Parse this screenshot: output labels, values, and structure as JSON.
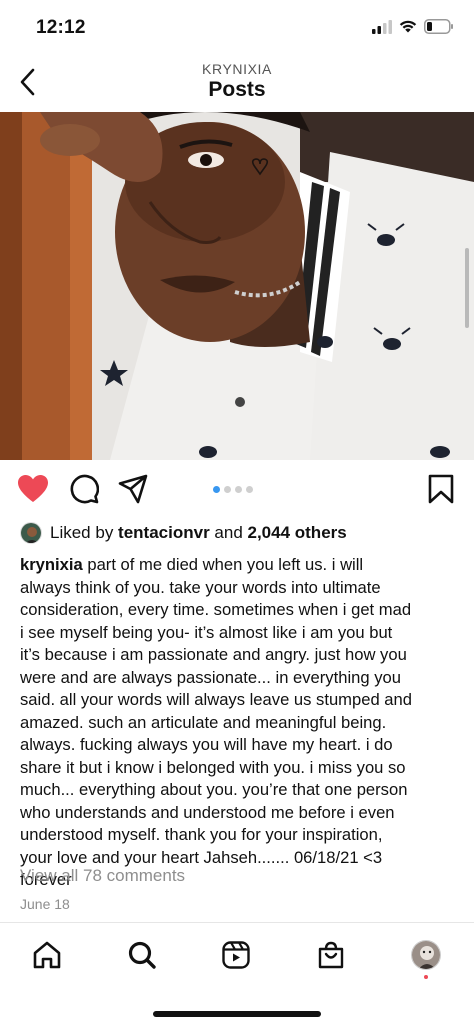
{
  "status_bar": {
    "time": "12:12"
  },
  "header": {
    "account": "KRYNIXIA",
    "title": "Posts"
  },
  "carousel": {
    "slide_count": 4,
    "active_index": 0
  },
  "likes": {
    "prefix": "Liked by ",
    "liker": "tentacionvr",
    "middle": " and ",
    "count": "2,044 others"
  },
  "caption": {
    "username": "krynixia",
    "lines": [
      " part of me died when you left us. i will",
      "always think of you. take your words into ultimate",
      "consideration, every time. sometimes when i get mad",
      "i see myself being you- it’s almost like i am you but",
      "it’s because i am passionate and angry. just how you",
      "were and are always passionate... in everything you",
      "said. all your words will always leave us stumped and",
      "amazed. such an articulate and meaningful being.",
      "always. fucking always  you will have my heart. i do",
      "share it but i know i belonged with you. i miss you so",
      "much... everything about you. you’re that one person",
      "who understands and understood me before i even",
      "understood myself. thank you for your inspiration,",
      "your love and your heart Jahseh....... 06/18/21 <3",
      "forever"
    ]
  },
  "comments": {
    "view_all": "View all 78 comments"
  },
  "post_date": "June 18",
  "colors": {
    "like_red": "#ed4956",
    "dot_active": "#3897f0",
    "muted": "#8e8e8e"
  },
  "icons": {
    "status": [
      "signal-icon",
      "wifi-icon",
      "battery-icon"
    ],
    "actions": [
      "heart-icon",
      "comment-icon",
      "send-icon",
      "bookmark-icon"
    ],
    "nav": [
      "home-icon",
      "search-icon",
      "reels-icon",
      "shop-icon",
      "profile-avatar"
    ]
  }
}
